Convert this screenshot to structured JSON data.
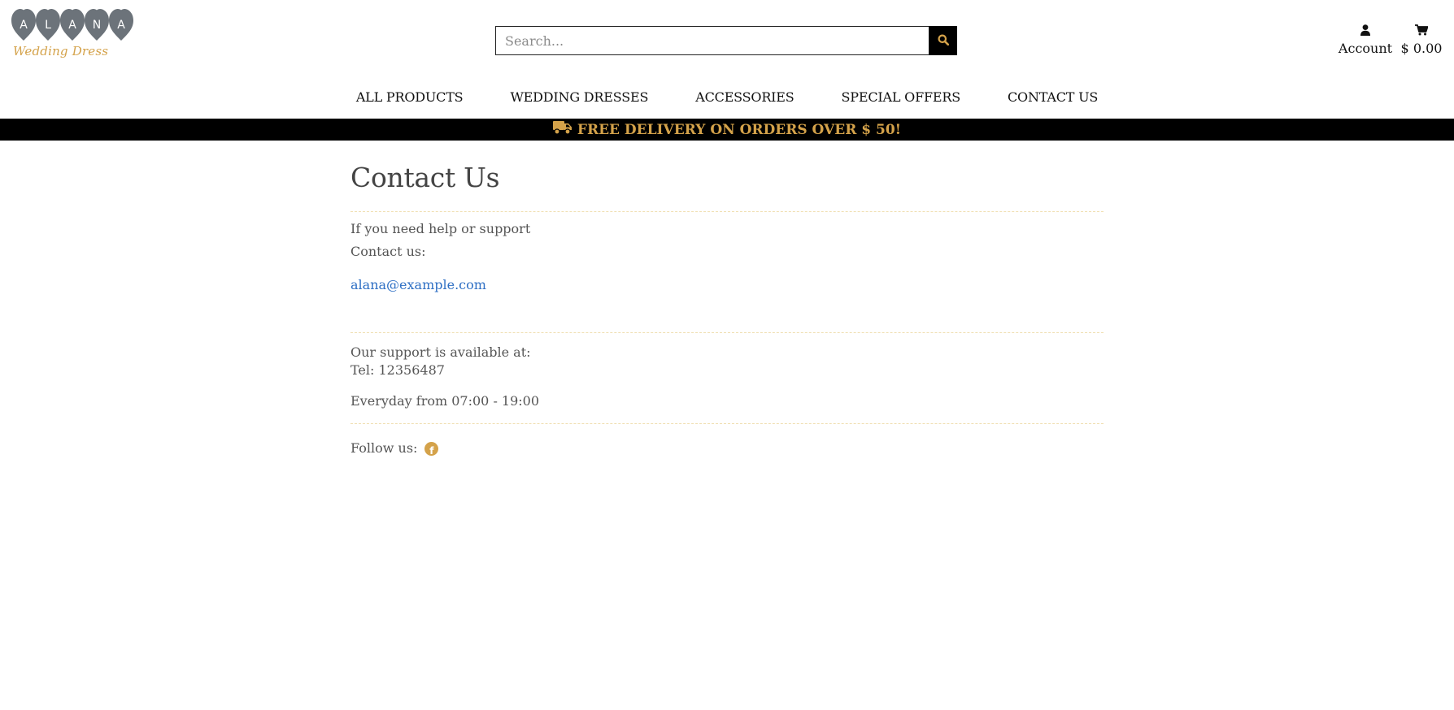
{
  "header": {
    "logo": {
      "letters": [
        "A",
        "L",
        "A",
        "N",
        "A"
      ],
      "subtitle": "Wedding Dress"
    },
    "search": {
      "placeholder": "Search...",
      "value": ""
    },
    "account_label": "Account",
    "cart_total": "$ 0.00"
  },
  "nav": {
    "items": [
      "ALL PRODUCTS",
      "WEDDING DRESSES",
      "ACCESSORIES",
      "SPECIAL OFFERS",
      "CONTACT US"
    ]
  },
  "banner": {
    "text": "FREE DELIVERY ON ORDERS OVER $ 50!"
  },
  "main": {
    "title": "Contact Us",
    "help_text": "If you need help or support",
    "contact_label": "Contact us:",
    "email": "alana@example.com",
    "support_text": "Our support is available at:",
    "tel": "Tel: 12356487",
    "hours": "Everyday from 07:00 - 19:00",
    "follow_label": "Follow us:"
  },
  "colors": {
    "accent": "#d4a24a",
    "banner_bg": "#000000",
    "link": "#2e6fc4",
    "logo_heart": "#6c737a",
    "divider": "#f0dfb2"
  },
  "icons": {
    "search": "search-icon",
    "account": "user-icon",
    "cart": "cart-icon",
    "banner": "truck-icon",
    "social": "facebook-icon"
  }
}
